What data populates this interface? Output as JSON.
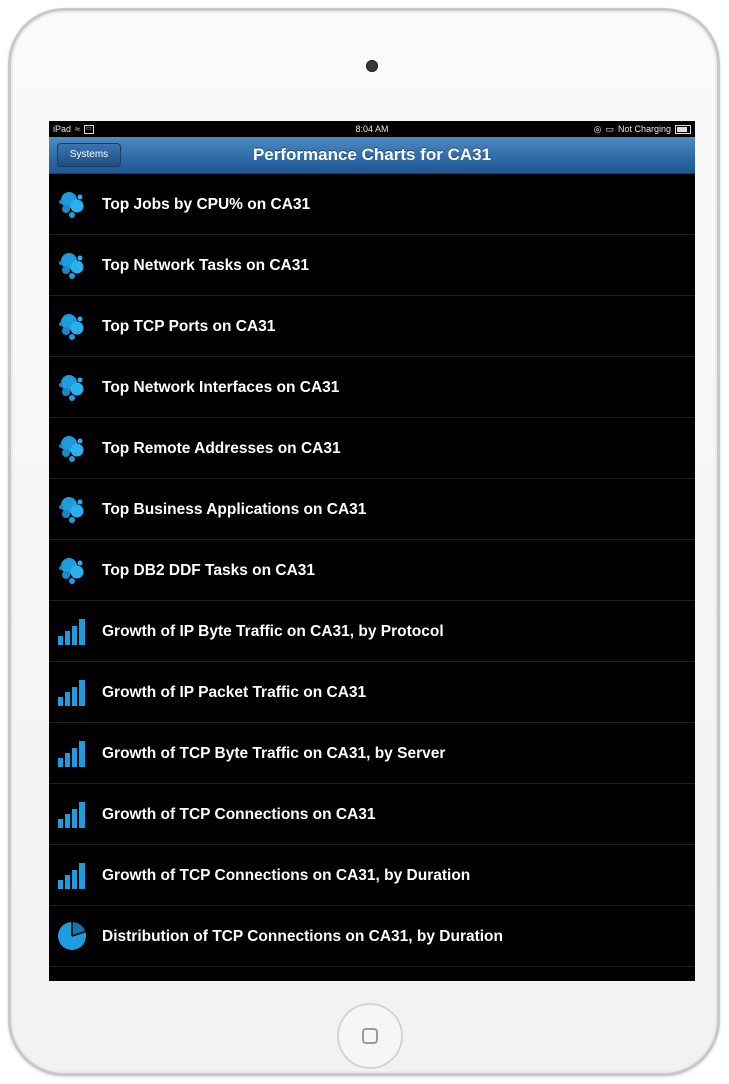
{
  "status_bar": {
    "device": "iPad",
    "time": "8:04 AM",
    "charging": "Not Charging"
  },
  "nav": {
    "back_label": "Systems",
    "title": "Performance Charts for CA31"
  },
  "colors": {
    "accent": "#2f6ca8",
    "icon_blue": "#1f9cde"
  },
  "items": [
    {
      "label": "Top Jobs by CPU% on CA31",
      "icon": "bubbles-icon"
    },
    {
      "label": "Top Network Tasks on CA31",
      "icon": "bubbles-icon"
    },
    {
      "label": "Top TCP Ports on CA31",
      "icon": "bubbles-icon"
    },
    {
      "label": "Top Network Interfaces on CA31",
      "icon": "bubbles-icon"
    },
    {
      "label": "Top Remote Addresses on CA31",
      "icon": "bubbles-icon"
    },
    {
      "label": "Top Business Applications on CA31",
      "icon": "bubbles-icon"
    },
    {
      "label": "Top DB2 DDF Tasks on CA31",
      "icon": "bubbles-icon"
    },
    {
      "label": "Growth of IP Byte Traffic on CA31, by Protocol",
      "icon": "bar-chart-icon"
    },
    {
      "label": "Growth of IP Packet Traffic on CA31",
      "icon": "bar-chart-icon"
    },
    {
      "label": "Growth of TCP Byte Traffic on CA31, by Server",
      "icon": "bar-chart-icon"
    },
    {
      "label": "Growth of TCP Connections on CA31",
      "icon": "bar-chart-icon"
    },
    {
      "label": "Growth of TCP Connections on CA31, by Duration",
      "icon": "bar-chart-icon"
    },
    {
      "label": "Distribution of TCP Connections on CA31, by Duration",
      "icon": "pie-chart-icon"
    }
  ]
}
